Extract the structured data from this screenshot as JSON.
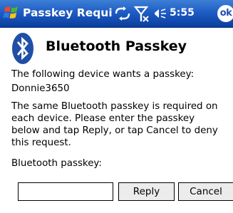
{
  "title_bar": {
    "title": "Passkey Requir",
    "time": "5:55",
    "ok_label": "ok",
    "icons": [
      "windows-start-icon",
      "sync-icon",
      "signal-icon",
      "volume-icon"
    ]
  },
  "dialog": {
    "title": "Bluetooth Passkey",
    "logo_icon": "bluetooth-icon",
    "intro": "The following device wants a passkey:",
    "device_name": "Donnie3650",
    "explanation_lines": [
      "The same Bluetooth passkey is required on",
      "each device. Please enter the passkey",
      "below and tap Reply, or tap Cancel to deny",
      "this request."
    ],
    "field_label": "Bluetooth passkey:",
    "passkey_value": "",
    "reply_label": "Reply",
    "cancel_label": "Cancel"
  },
  "colors": {
    "title_bar": "#1e5cc4",
    "bluetooth_blue": "#1f4fa6",
    "background": "#ffffff"
  }
}
